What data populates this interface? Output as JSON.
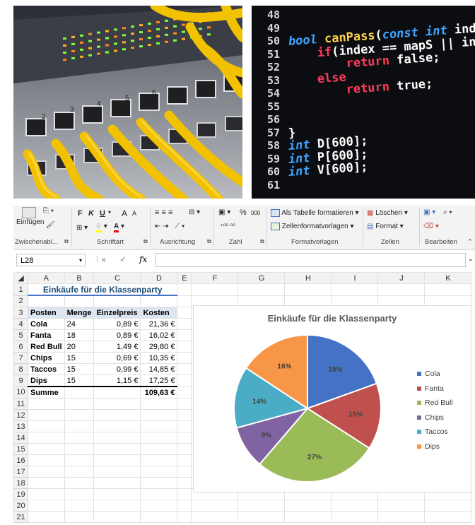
{
  "code": {
    "lines": [
      {
        "no": "48",
        "text": ""
      },
      {
        "no": "49",
        "text": ""
      },
      {
        "no": "50",
        "text": "bool canPass(const int index)"
      },
      {
        "no": "51",
        "text": "    if(index == mapS || index"
      },
      {
        "no": "52",
        "text": "        return false;"
      },
      {
        "no": "53",
        "text": "    else"
      },
      {
        "no": "54",
        "text": "        return true;"
      },
      {
        "no": "55",
        "text": ""
      },
      {
        "no": "56",
        "text": ""
      },
      {
        "no": "57",
        "text": "}"
      },
      {
        "no": "58",
        "text": "int D[600];"
      },
      {
        "no": "59",
        "text": "int P[600];"
      },
      {
        "no": "60",
        "text": "int V[600];"
      },
      {
        "no": "61",
        "text": ""
      }
    ]
  },
  "ribbon": {
    "paste": "Einfügen",
    "font_bold": "F",
    "font_italic": "K",
    "font_underline": "U",
    "grow": "A",
    "shrink": "A",
    "percent": "%",
    "thousands": "000",
    "increase_dec": "←,0 ,00",
    "format_as_table": "Als Tabelle formatieren",
    "cell_styles": "Zellenformatvorlagen",
    "delete": "Löschen",
    "format": "Format",
    "groups": {
      "clipboard": "Zwischenabl...",
      "font": "Schriftart",
      "alignment": "Ausrichtung",
      "number": "Zahl",
      "styles": "Formatvorlagen",
      "cells": "Zellen",
      "editing": "Bearbeiten"
    }
  },
  "formula_bar": {
    "cell_ref": "L28",
    "fx": "fx",
    "cancel": "×",
    "enter": "✓",
    "value": ""
  },
  "sheet": {
    "columns": [
      "A",
      "B",
      "C",
      "D",
      "E",
      "F",
      "G",
      "H",
      "I",
      "J",
      "K"
    ],
    "rows": [
      "1",
      "2",
      "3",
      "4",
      "5",
      "6",
      "7",
      "8",
      "9",
      "10",
      "11",
      "12",
      "13",
      "14",
      "15",
      "16",
      "17",
      "18",
      "19",
      "20",
      "21"
    ],
    "title": "Einkäufe für die Klassenparty",
    "headers": {
      "posten": "Posten",
      "menge": "Menge",
      "einzelpreis": "Einzelpreis",
      "kosten": "Kosten"
    },
    "items": [
      {
        "posten": "Cola",
        "menge": "24",
        "preis": "0,89 €",
        "kosten": "21,36 €"
      },
      {
        "posten": "Fanta",
        "menge": "18",
        "preis": "0,89 €",
        "kosten": "16,02 €"
      },
      {
        "posten": "Red Bull",
        "menge": "20",
        "preis": "1,49 €",
        "kosten": "29,80 €"
      },
      {
        "posten": "Chips",
        "menge": "15",
        "preis": "0,69 €",
        "kosten": "10,35 €"
      },
      {
        "posten": "Taccos",
        "menge": "15",
        "preis": "0,99 €",
        "kosten": "14,85 €"
      },
      {
        "posten": "Dips",
        "menge": "15",
        "preis": "1,15 €",
        "kosten": "17,25 €"
      }
    ],
    "sum_label": "Summe",
    "sum_value": "109,63 €"
  },
  "chart_data": {
    "type": "pie",
    "title": "Einkäufe für die Klassenparty",
    "categories": [
      "Cola",
      "Fanta",
      "Red Bull",
      "Chips",
      "Taccos",
      "Dips"
    ],
    "values": [
      21.36,
      16.02,
      29.8,
      10.35,
      14.85,
      17.25
    ],
    "labels": [
      "19%",
      "15%",
      "27%",
      "9%",
      "14%",
      "16%"
    ],
    "colors": [
      "#4472c4",
      "#c0504d",
      "#9bbb59",
      "#8064a2",
      "#4bacc6",
      "#f79646"
    ],
    "legend": "right"
  }
}
